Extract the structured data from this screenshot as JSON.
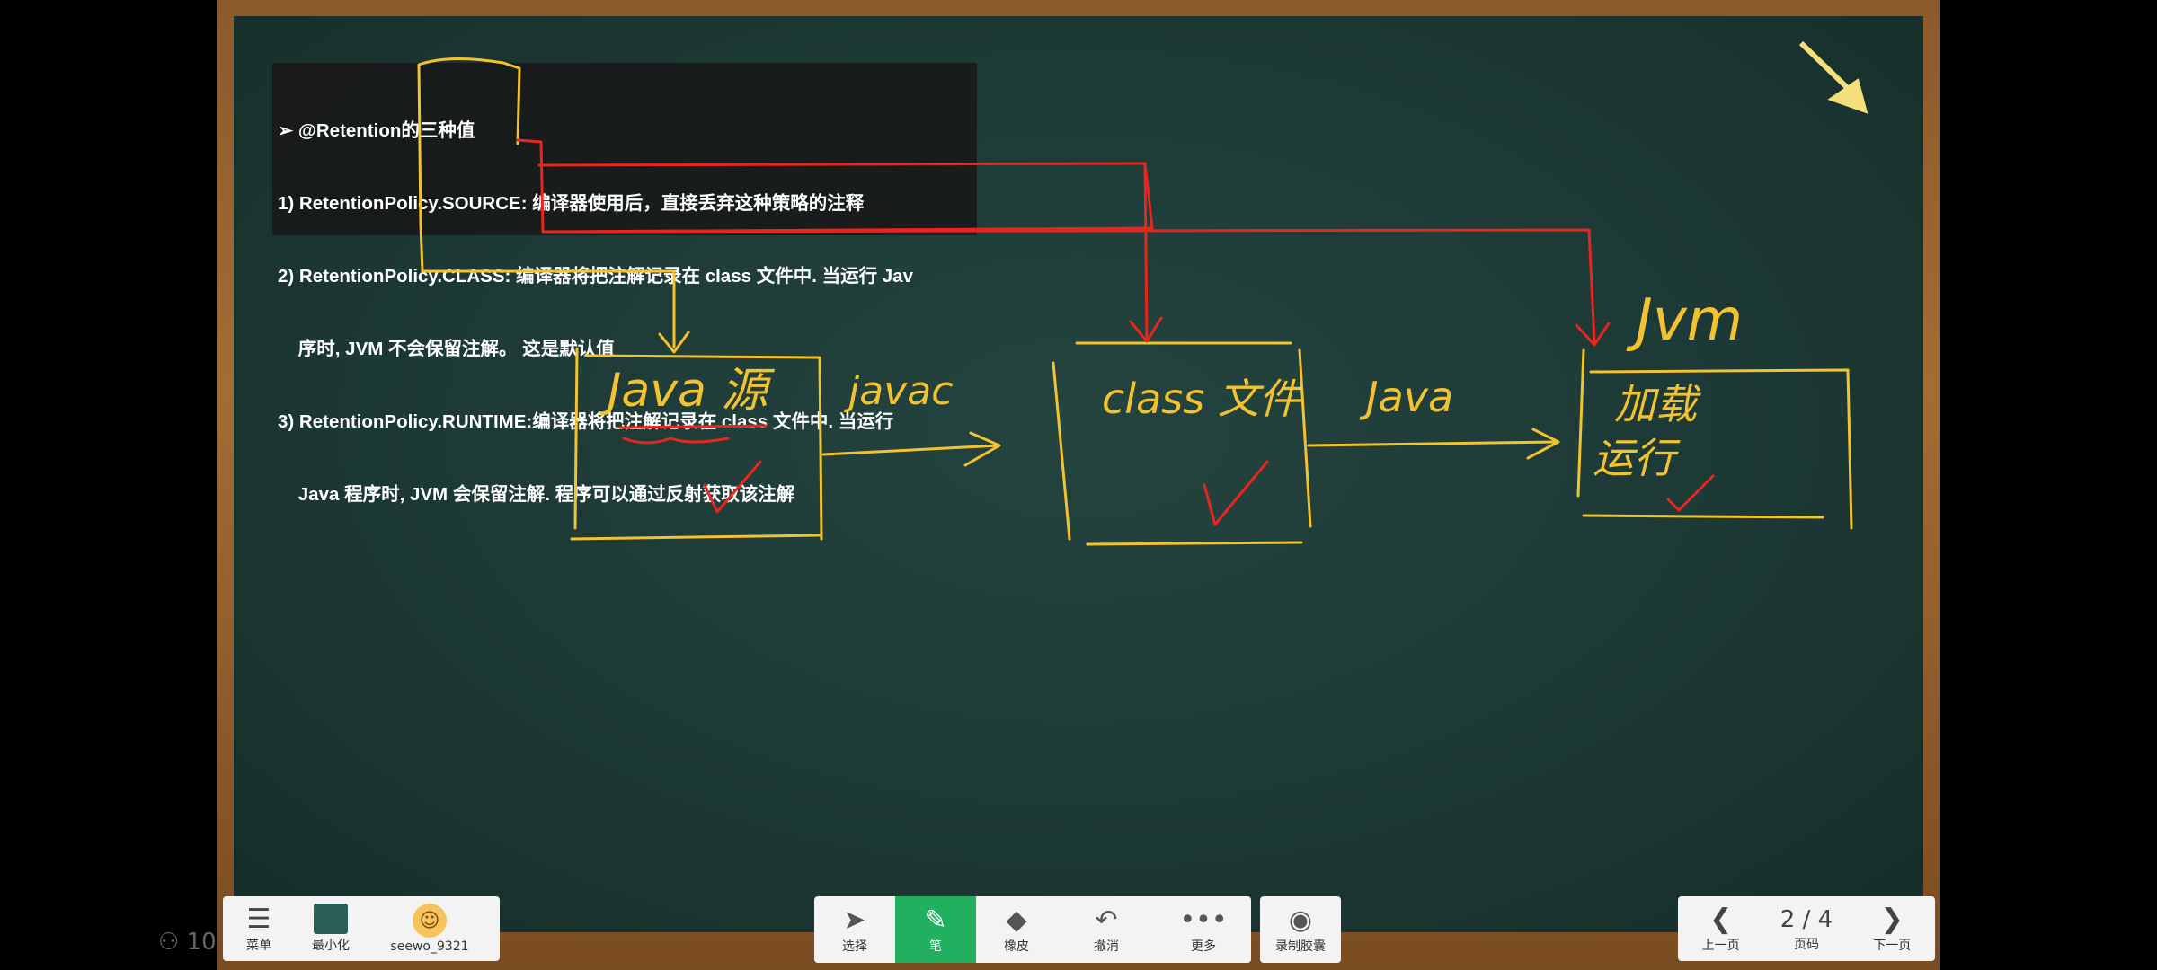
{
  "slide": {
    "lines": [
      "➢ @Retention的三种值",
      "1) RetentionPolicy.SOURCE: 编译器使用后，直接丢弃这种策略的注释",
      "2) RetentionPolicy.CLASS: 编译器将把注解记录在 class 文件中. 当运行 Jav",
      "    序时, JVM 不会保留注解。 这是默认值",
      "3) RetentionPolicy.RUNTIME:编译器将把注解记录在 class 文件中. 当运行",
      "    Java 程序时, JVM 会保留注解. 程序可以通过反射获取该注解"
    ]
  },
  "handwriting": {
    "box1": "Java 源",
    "arrow1": "javac",
    "box2": "class 文件",
    "arrow2": "Java",
    "box3_title": "Jvm",
    "box3_line1": "加载",
    "box3_line2": "运行"
  },
  "left_toolbar": {
    "menu_label": "菜单",
    "minimize_label": "最小化",
    "user_label": "seewo_9321"
  },
  "mid_toolbar": {
    "select_label": "选择",
    "pen_label": "笔",
    "eraser_label": "橡皮",
    "undo_label": "撤消",
    "more_label": "更多",
    "record_label": "录制胶囊"
  },
  "right_toolbar": {
    "prev_label": "上一页",
    "page_label": "页码",
    "page_value": "2 / 4",
    "next_label": "下一页"
  },
  "viewer_count": "10",
  "colors": {
    "ink_yellow": "#f2c230",
    "ink_red": "#e8251f",
    "pen_active": "#22b060"
  }
}
